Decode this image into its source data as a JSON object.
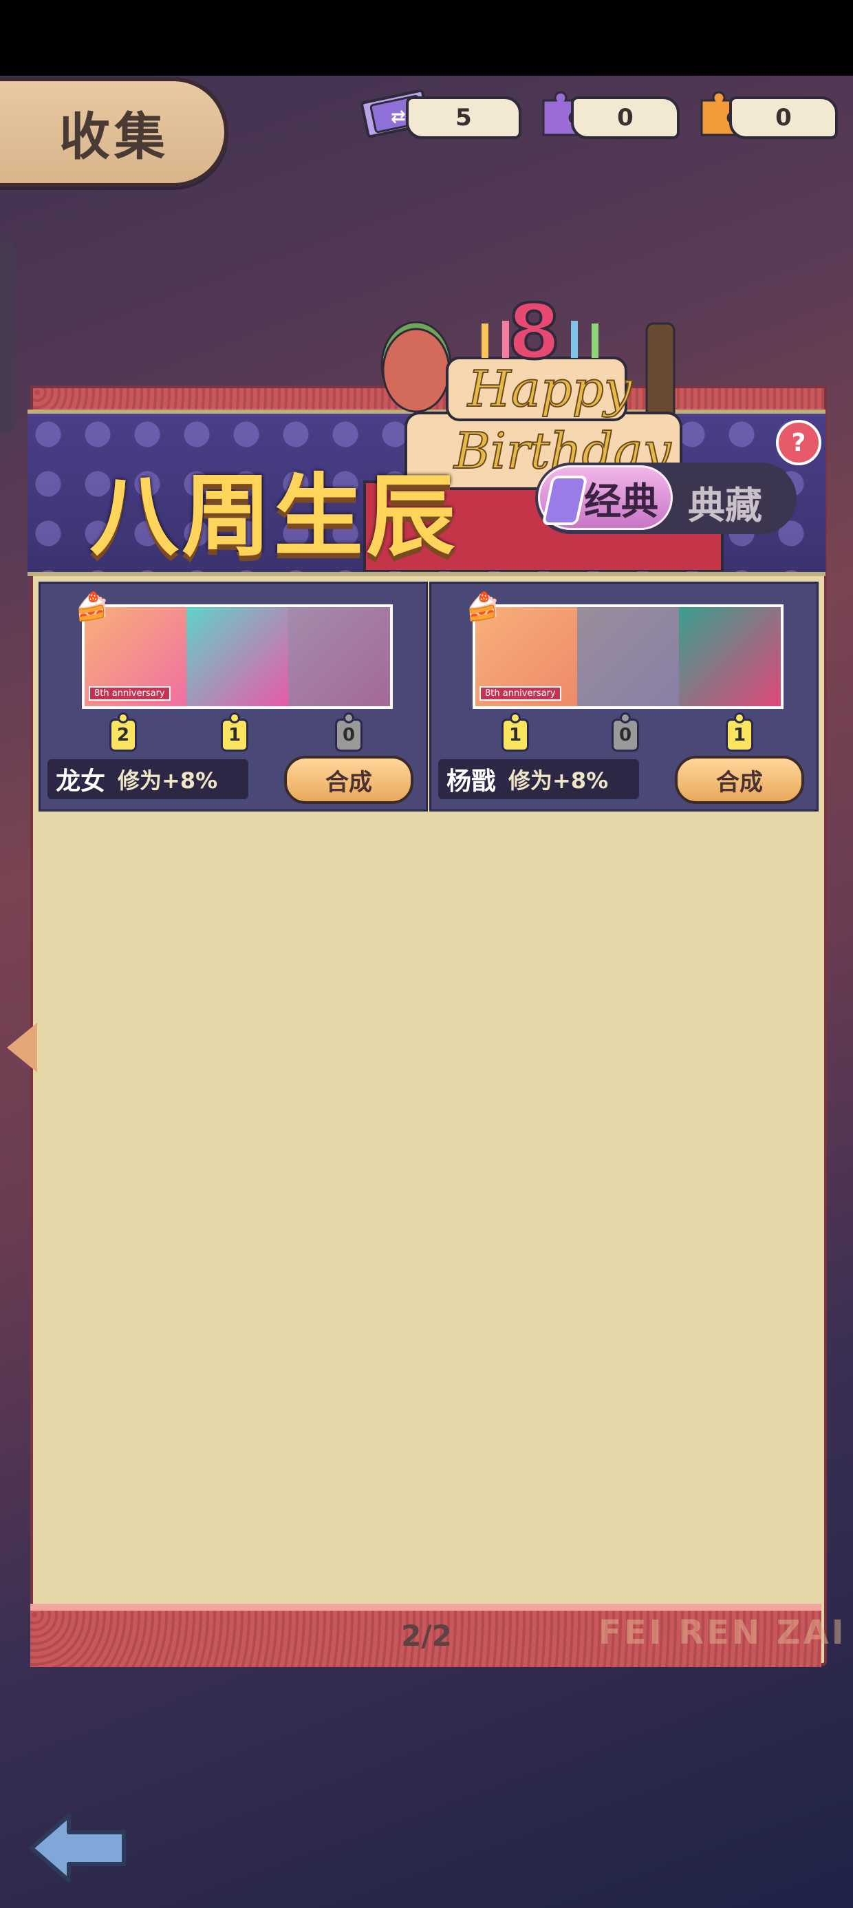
{
  "header": {
    "title": "收集"
  },
  "currencies": [
    {
      "icon": "ticket-icon",
      "value": "5"
    },
    {
      "icon": "purple-puzzle-icon",
      "value": "0"
    },
    {
      "icon": "orange-puzzle-icon",
      "value": "0"
    }
  ],
  "banner": {
    "title": "八周生辰",
    "tabs": {
      "active": "经典",
      "inactive": "典藏"
    },
    "help": "?"
  },
  "cards": [
    {
      "name": "龙女",
      "bonus": "修为+8%",
      "anniversary": "8th anniversary",
      "counts": [
        "2",
        "1",
        "0"
      ],
      "synth_label": "合成"
    },
    {
      "name": "杨戬",
      "bonus": "修为+8%",
      "anniversary": "8th anniversary",
      "counts": [
        "1",
        "0",
        "1"
      ],
      "synth_label": "合成"
    }
  ],
  "footer": {
    "page": "2/2",
    "brand": "FEI REN ZAI"
  },
  "colors": {
    "accent": "#ffd45a",
    "panel": "#e6d7a8",
    "banner": "#4a3f88"
  }
}
